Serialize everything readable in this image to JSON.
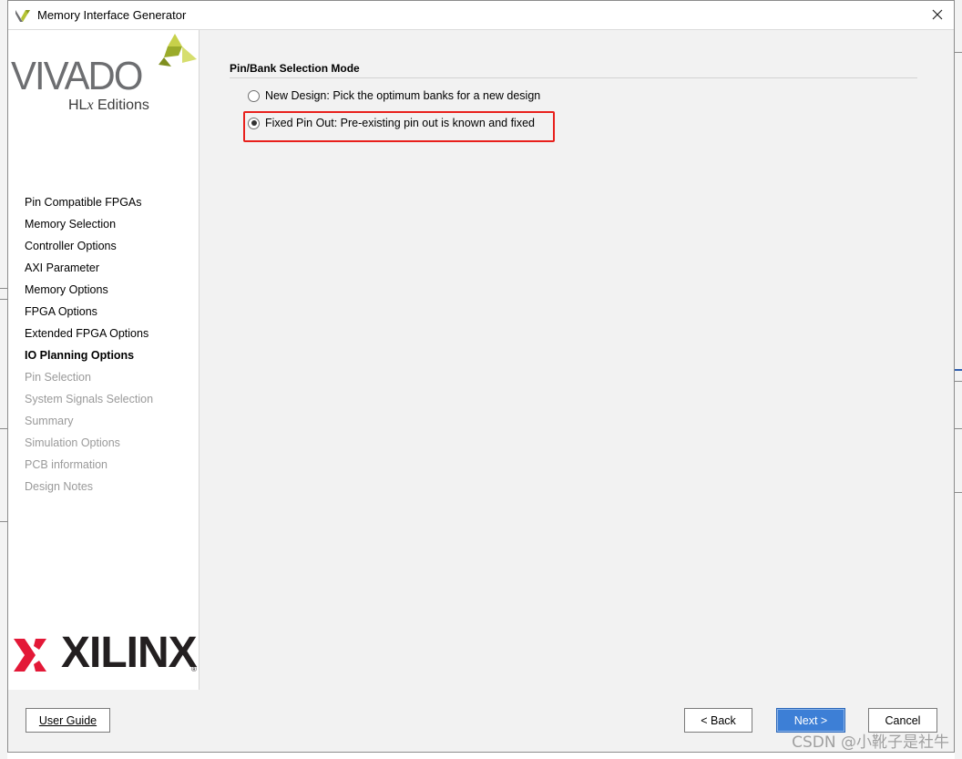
{
  "window": {
    "title": "Memory Interface Generator"
  },
  "branding": {
    "vivado": "VIVADO",
    "hlx_prefix": "HL",
    "hlx_x": "x",
    "hlx_suffix": " Editions",
    "xilinx": "XILINX",
    "registered": "®"
  },
  "sidebar": {
    "steps": [
      {
        "label": "Pin Compatible FPGAs",
        "state": "done"
      },
      {
        "label": "Memory Selection",
        "state": "done"
      },
      {
        "label": "Controller Options",
        "state": "done"
      },
      {
        "label": "AXI Parameter",
        "state": "done"
      },
      {
        "label": "Memory Options",
        "state": "done"
      },
      {
        "label": "FPGA Options",
        "state": "done"
      },
      {
        "label": "Extended FPGA Options",
        "state": "done"
      },
      {
        "label": "IO Planning Options",
        "state": "active"
      },
      {
        "label": "Pin Selection",
        "state": "future"
      },
      {
        "label": "System Signals Selection",
        "state": "future"
      },
      {
        "label": "Summary",
        "state": "future"
      },
      {
        "label": "Simulation Options",
        "state": "future"
      },
      {
        "label": "PCB information",
        "state": "future"
      },
      {
        "label": "Design Notes",
        "state": "future"
      }
    ]
  },
  "main": {
    "section_title": "Pin/Bank Selection Mode",
    "options": [
      {
        "label": "New Design: Pick the optimum banks for a new design",
        "checked": false
      },
      {
        "label": "Fixed Pin Out: Pre-existing pin out is known and fixed",
        "checked": true
      }
    ]
  },
  "footer": {
    "user_guide": "User Guide",
    "back": "< Back",
    "next": "Next >",
    "cancel": "Cancel"
  },
  "watermark": "CSDN @小靴子是社牛",
  "colors": {
    "highlight": "#e8201c",
    "primary_button": "#3d7fd6",
    "vivado_gray": "#6d6e71",
    "vivado_green": "#b5c334",
    "xilinx_red": "#e31837"
  }
}
